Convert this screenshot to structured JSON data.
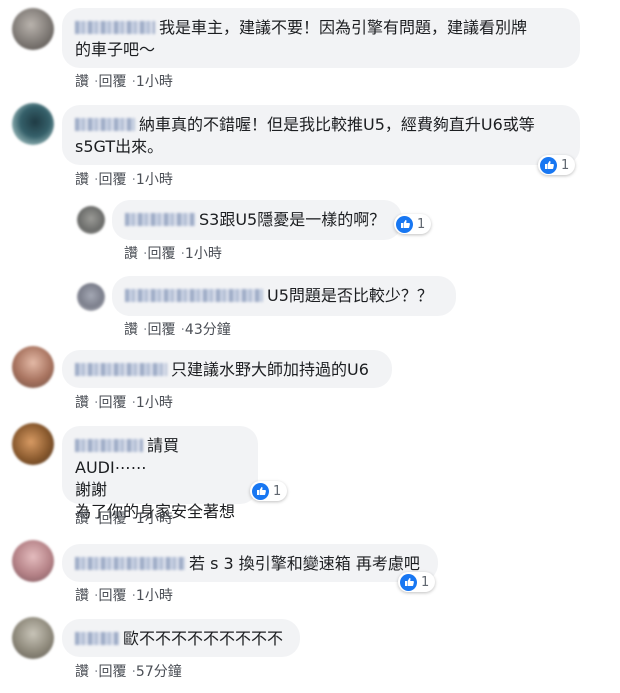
{
  "actions": {
    "like": "讚",
    "reply": "回覆"
  },
  "comments": [
    {
      "id": "c1",
      "text": "我是車主，建議不要！因為引擎有問題，建議看別牌\n的車子吧～",
      "time": "1小時",
      "reactions": null
    },
    {
      "id": "c2",
      "text": "納車真的不錯喔！但是我比較推U5，經費夠直升U6或等\ns5GT出來。",
      "time": "1小時",
      "reactions": "1",
      "replies": [
        {
          "id": "r1",
          "text": "S3跟U5隱憂是一樣的啊？",
          "time": "1小時",
          "reactions": "1"
        },
        {
          "id": "r2",
          "text": "U5問題是否比較少？？",
          "time": "43分鐘",
          "reactions": null
        }
      ]
    },
    {
      "id": "c3",
      "text": "只建議水野大師加持過的U6",
      "time": "1小時",
      "reactions": null
    },
    {
      "id": "c4",
      "text": "請買AUDI⋯⋯\n謝謝\n為了你的身家安全著想",
      "time": "1小時",
      "reactions": "1"
    },
    {
      "id": "c5",
      "text": "若 s 3 換引擎和變速箱 再考慮吧",
      "time": "1小時",
      "reactions": "1"
    },
    {
      "id": "c6",
      "text": "歐不不不不不不不不不",
      "time": "57分鐘",
      "reactions": null
    }
  ],
  "colors": {
    "bubble": "#f2f3f5",
    "like_blue": "#1877f2",
    "action_text": "#4b4f56"
  }
}
